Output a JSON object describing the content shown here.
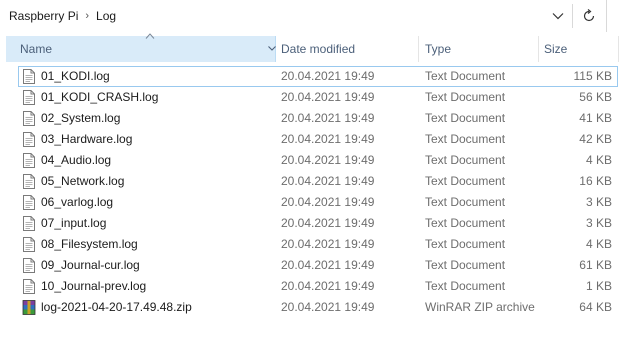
{
  "address": {
    "crumbs": [
      "Raspberry Pi",
      "Log"
    ],
    "separator": "›"
  },
  "columns": {
    "name": "Name",
    "date": "Date modified",
    "type": "Type",
    "size": "Size"
  },
  "files": [
    {
      "name": "01_KODI.log",
      "date": "20.04.2021 19:49",
      "type": "Text Document",
      "size": "115 KB",
      "icon": "text-document-icon"
    },
    {
      "name": "01_KODI_CRASH.log",
      "date": "20.04.2021 19:49",
      "type": "Text Document",
      "size": "56 KB",
      "icon": "text-document-icon"
    },
    {
      "name": "02_System.log",
      "date": "20.04.2021 19:49",
      "type": "Text Document",
      "size": "41 KB",
      "icon": "text-document-icon"
    },
    {
      "name": "03_Hardware.log",
      "date": "20.04.2021 19:49",
      "type": "Text Document",
      "size": "42 KB",
      "icon": "text-document-icon"
    },
    {
      "name": "04_Audio.log",
      "date": "20.04.2021 19:49",
      "type": "Text Document",
      "size": "4 KB",
      "icon": "text-document-icon"
    },
    {
      "name": "05_Network.log",
      "date": "20.04.2021 19:49",
      "type": "Text Document",
      "size": "16 KB",
      "icon": "text-document-icon"
    },
    {
      "name": "06_varlog.log",
      "date": "20.04.2021 19:49",
      "type": "Text Document",
      "size": "3 KB",
      "icon": "text-document-icon"
    },
    {
      "name": "07_input.log",
      "date": "20.04.2021 19:49",
      "type": "Text Document",
      "size": "3 KB",
      "icon": "text-document-icon"
    },
    {
      "name": "08_Filesystem.log",
      "date": "20.04.2021 19:49",
      "type": "Text Document",
      "size": "4 KB",
      "icon": "text-document-icon"
    },
    {
      "name": "09_Journal-cur.log",
      "date": "20.04.2021 19:49",
      "type": "Text Document",
      "size": "61 KB",
      "icon": "text-document-icon"
    },
    {
      "name": "10_Journal-prev.log",
      "date": "20.04.2021 19:49",
      "type": "Text Document",
      "size": "1 KB",
      "icon": "text-document-icon"
    },
    {
      "name": "log-2021-04-20-17.49.48.zip",
      "date": "20.04.2021 19:49",
      "type": "WinRAR ZIP archive",
      "size": "64 KB",
      "icon": "winrar-archive-icon"
    }
  ],
  "colors": {
    "header_selected_bg": "#d9ebf9",
    "header_text": "#4c607a",
    "focus_border": "#99c9ef",
    "secondary_text": "#6d6d6d"
  }
}
